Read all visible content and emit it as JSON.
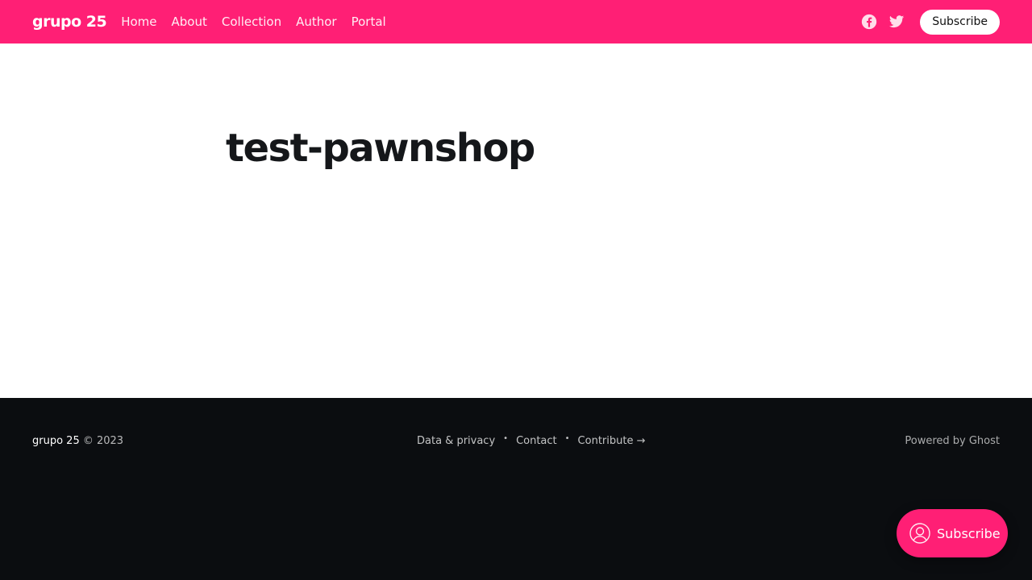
{
  "header": {
    "logo": "grupo 25",
    "nav": [
      "Home",
      "About",
      "Collection",
      "Author",
      "Portal"
    ],
    "social": [
      "facebook-icon",
      "twitter-icon"
    ],
    "subscribe_label": "Subscribe"
  },
  "main": {
    "title": "test-pawnshop"
  },
  "footer": {
    "brand": "grupo 25",
    "copyright": "© 2023",
    "links": [
      "Data & privacy",
      "Contact",
      "Contribute →"
    ],
    "powered": "Powered by Ghost"
  },
  "portal": {
    "label": "Subscribe"
  },
  "colors": {
    "accent": "#ff1f75",
    "footer_bg": "#0b0d10"
  }
}
